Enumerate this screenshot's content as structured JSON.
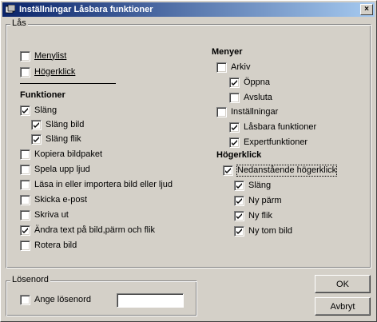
{
  "window": {
    "title": "Inställningar Låsbara funktioner",
    "close_glyph": "×"
  },
  "las_group": {
    "legend": "Lås",
    "menylist": {
      "label": "Menylist",
      "checked": false
    },
    "hogerklick": {
      "label": "Högerklick",
      "checked": false
    },
    "funktioner": {
      "heading": "Funktioner",
      "items": [
        {
          "label": "Släng",
          "checked": true
        },
        {
          "label": "Släng bild",
          "checked": true
        },
        {
          "label": "Släng flik",
          "checked": true
        },
        {
          "label": "Kopiera bildpaket",
          "checked": false
        },
        {
          "label": "Spela upp ljud",
          "checked": false
        },
        {
          "label": "Läsa in eller importera bild eller ljud",
          "checked": false
        },
        {
          "label": "Skicka e-post",
          "checked": false
        },
        {
          "label": "Skriva ut",
          "checked": false
        },
        {
          "label": "Ändra text på bild,pärm och flik",
          "checked": true
        },
        {
          "label": "Rotera bild",
          "checked": false
        }
      ]
    },
    "menyer": {
      "heading": "Menyer",
      "items": [
        {
          "label": "Arkiv",
          "checked": false
        },
        {
          "label": "Öppna",
          "checked": true
        },
        {
          "label": "Avsluta",
          "checked": false
        },
        {
          "label": "Inställningar",
          "checked": false
        },
        {
          "label": "Låsbara funktioner",
          "checked": true
        },
        {
          "label": "Expertfunktioner",
          "checked": true
        }
      ]
    },
    "hogerklick_section": {
      "heading": "Högerklick",
      "items": [
        {
          "label": "Nedanstående högerklick",
          "checked": true
        },
        {
          "label": "Släng",
          "checked": true
        },
        {
          "label": "Ny pärm",
          "checked": true
        },
        {
          "label": "Ny flik",
          "checked": true
        },
        {
          "label": "Ny tom bild",
          "checked": true
        }
      ]
    }
  },
  "losenord_group": {
    "legend": "Lösenord",
    "ange": {
      "label": "Ange lösenord",
      "checked": false
    },
    "password_value": ""
  },
  "buttons": {
    "ok": "OK",
    "avbryt": "Avbryt"
  },
  "colors": {
    "face": "#d4d0c8",
    "title_start": "#0a246a",
    "title_end": "#a6caf0"
  }
}
